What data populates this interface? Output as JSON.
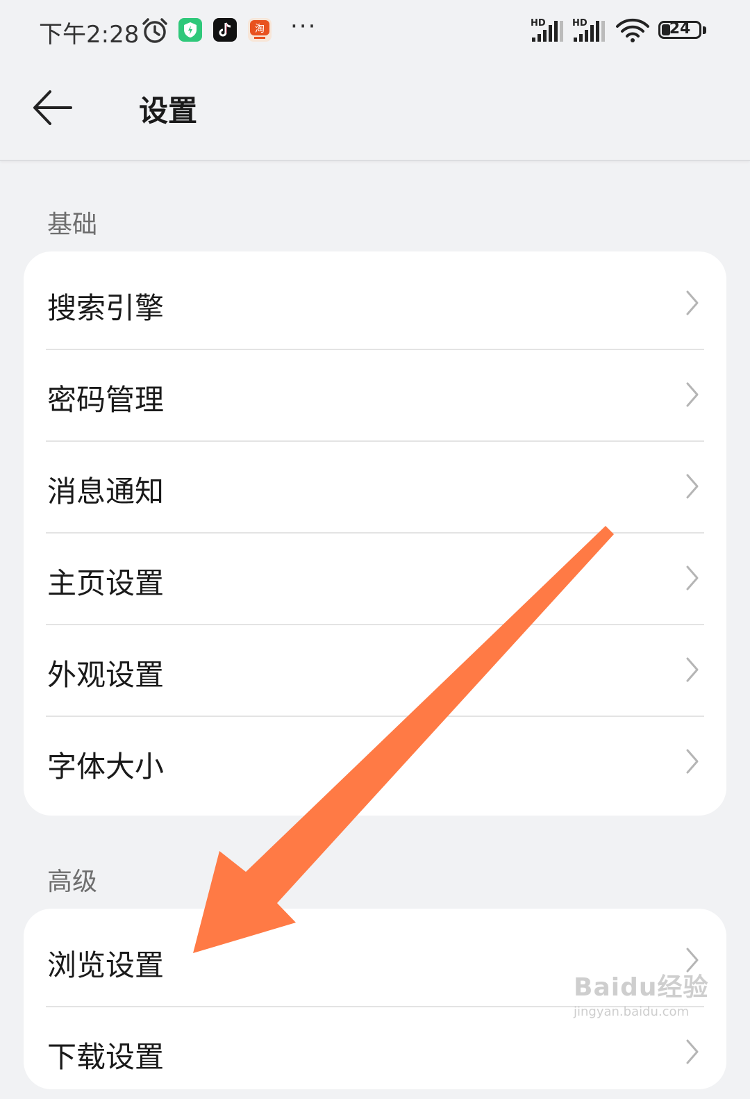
{
  "status_bar": {
    "time": "下午2:28",
    "battery": "24",
    "battery_level": 0.24,
    "icons": [
      "alarm-icon",
      "security-app-icon",
      "tiktok-app-icon",
      "shopping-app-icon",
      "more-dots-icon",
      "hd-signal-icon",
      "hd-signal-icon",
      "wifi-icon",
      "battery-icon"
    ],
    "signal_label_1": "HD",
    "signal_label_2": "HD",
    "more": "···"
  },
  "header": {
    "title": "设置",
    "back_icon": "arrow-left-icon"
  },
  "sections": [
    {
      "label": "基础",
      "items": [
        {
          "label": "搜索引擎"
        },
        {
          "label": "密码管理"
        },
        {
          "label": "消息通知"
        },
        {
          "label": "主页设置"
        },
        {
          "label": "外观设置"
        },
        {
          "label": "字体大小"
        }
      ]
    },
    {
      "label": "高级",
      "items": [
        {
          "label": "浏览设置"
        },
        {
          "label": "下载设置"
        }
      ]
    }
  ],
  "colors": {
    "background": "#f1f2f4",
    "card": "#ffffff",
    "annotation_arrow": "#ff7a45"
  },
  "watermark": {
    "main": "Baidu经验",
    "sub": "jingyan.baidu.com"
  }
}
